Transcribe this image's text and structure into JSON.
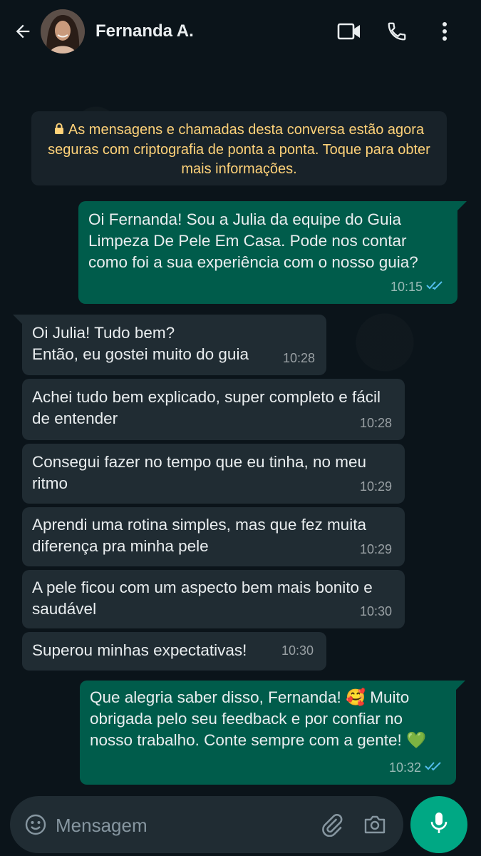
{
  "header": {
    "contact_name": "Fernanda A."
  },
  "encryption_notice": "As mensagens e chamadas desta conversa estão agora seguras com criptografia de ponta a ponta. Toque para obter mais informações.",
  "messages": [
    {
      "direction": "out",
      "text": "Oi Fernanda! Sou a Julia da equipe do Guia Limpeza De Pele Em Casa. Pode nos contar como foi a sua experiência com o nosso guia?",
      "time": "10:15",
      "status": "read"
    },
    {
      "direction": "in",
      "text": "Oi Julia! Tudo bem?\nEntão, eu gostei muito do guia",
      "time": "10:28"
    },
    {
      "direction": "in",
      "text": "Achei tudo bem explicado, super completo e fácil de entender",
      "time": "10:28"
    },
    {
      "direction": "in",
      "text": "Consegui fazer no tempo que eu tinha, no meu ritmo",
      "time": "10:29"
    },
    {
      "direction": "in",
      "text": "Aprendi uma rotina simples, mas que fez muita diferença pra minha pele",
      "time": "10:29"
    },
    {
      "direction": "in",
      "text": "A pele ficou com um aspecto bem mais bonito e saudável",
      "time": "10:30"
    },
    {
      "direction": "in",
      "text": "Superou minhas expectativas!",
      "time": "10:30"
    },
    {
      "direction": "out",
      "text": "Que alegria saber disso, Fernanda! 🥰 Muito obrigada pelo seu feedback e por confiar no nosso trabalho. Conte sempre com a gente! 💚",
      "time": "10:32",
      "status": "read"
    }
  ],
  "composer": {
    "placeholder": "Mensagem"
  },
  "colors": {
    "background": "#0b141a",
    "outgoing_bubble": "#005c4b",
    "incoming_bubble": "#202c33",
    "encryption_text": "#ffd279",
    "read_ticks": "#53bdeb",
    "mic_button": "#00a884"
  },
  "icons": {
    "back": "arrow-left",
    "video_call": "video-camera",
    "voice_call": "phone",
    "menu": "three-dots-vertical",
    "lock": "lock",
    "emoji": "smiley",
    "attach": "paperclip",
    "camera": "camera",
    "mic": "microphone",
    "read_status": "double-check"
  }
}
